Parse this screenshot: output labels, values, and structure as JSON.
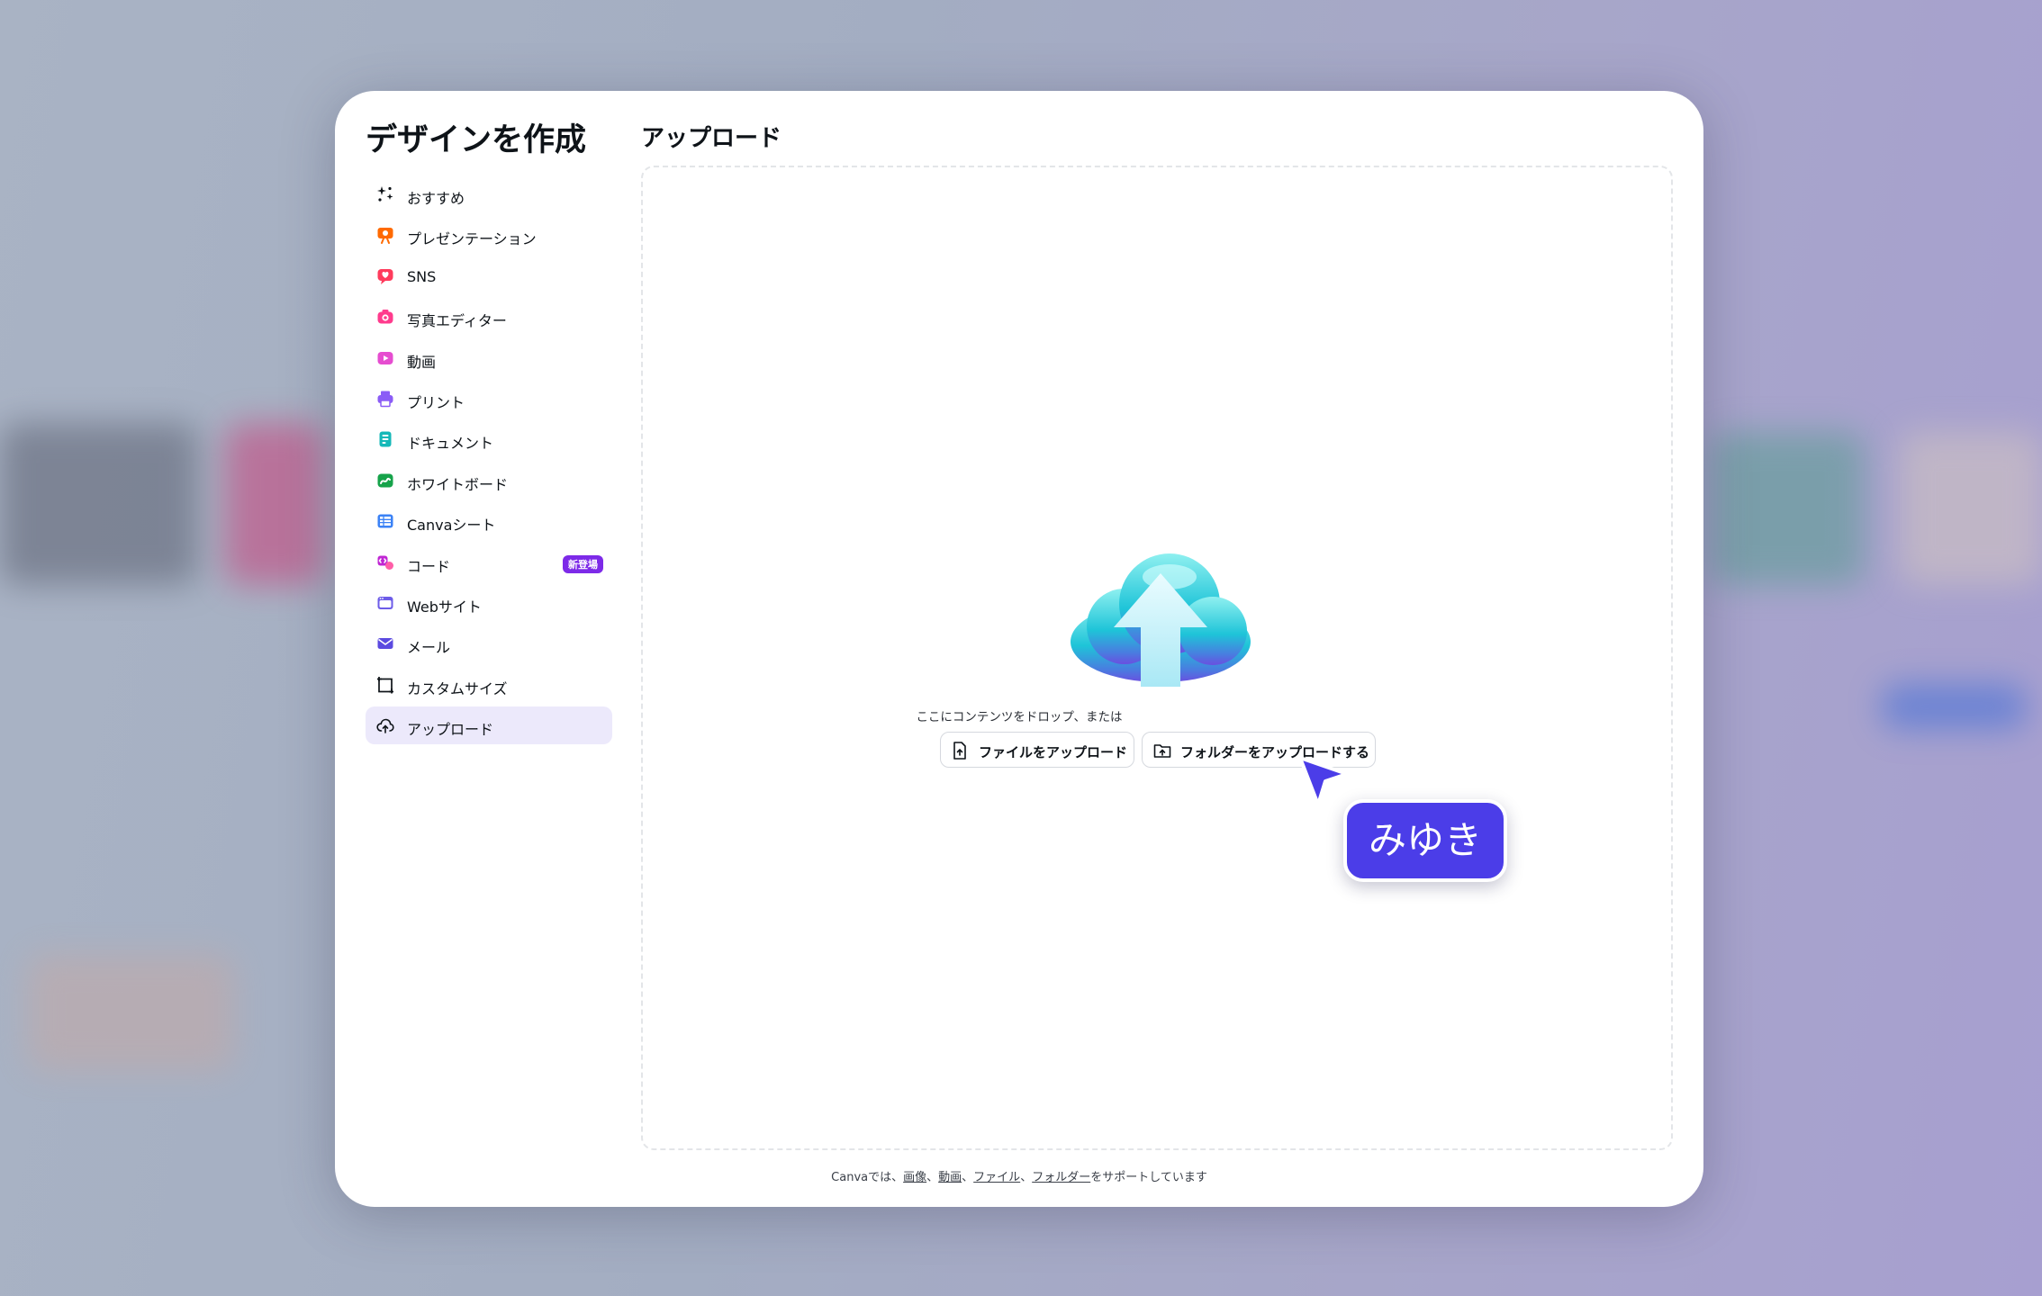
{
  "modal": {
    "title": "デザインを作成",
    "section_title": "アップロード"
  },
  "nav": {
    "items": [
      {
        "label": "おすすめ",
        "icon": "sparkle-icon",
        "color": "#0e1318"
      },
      {
        "label": "プレゼンテーション",
        "icon": "presentation-icon",
        "color": "#ff6a00"
      },
      {
        "label": "SNS",
        "icon": "heart-chat-icon",
        "color": "#ff3b5c"
      },
      {
        "label": "写真エディター",
        "icon": "camera-icon",
        "color": "#ff3b8d"
      },
      {
        "label": "動画",
        "icon": "video-icon",
        "color": "#e64dd0"
      },
      {
        "label": "プリント",
        "icon": "printer-icon",
        "color": "#8b5cf6"
      },
      {
        "label": "ドキュメント",
        "icon": "document-icon",
        "color": "#14b8b8"
      },
      {
        "label": "ホワイトボード",
        "icon": "whiteboard-icon",
        "color": "#16a34a"
      },
      {
        "label": "Canvaシート",
        "icon": "sheet-icon",
        "color": "#3b82f6"
      },
      {
        "label": "コード",
        "icon": "code-icon",
        "color": "#c026d3",
        "badge": "新登場"
      },
      {
        "label": "Webサイト",
        "icon": "website-icon",
        "color": "#6d5ce8"
      },
      {
        "label": "メール",
        "icon": "mail-icon",
        "color": "#5b4ae0"
      },
      {
        "label": "カスタムサイズ",
        "icon": "custom-size-icon",
        "color": "#0e1318"
      },
      {
        "label": "アップロード",
        "icon": "cloud-upload-icon",
        "color": "#0e1318",
        "active": true
      }
    ]
  },
  "upload": {
    "drop_text": "ここにコンテンツをドロップ、または",
    "file_button": "ファイルをアップロード",
    "folder_button": "フォルダーをアップロードする"
  },
  "footer": {
    "prefix": "Canvaでは、",
    "links": [
      "画像",
      "動画",
      "ファイル",
      "フォルダー"
    ],
    "separator": "、",
    "suffix": "をサポートしています"
  },
  "cursor": {
    "user_name": "みゆき",
    "color": "#4b3de8"
  }
}
